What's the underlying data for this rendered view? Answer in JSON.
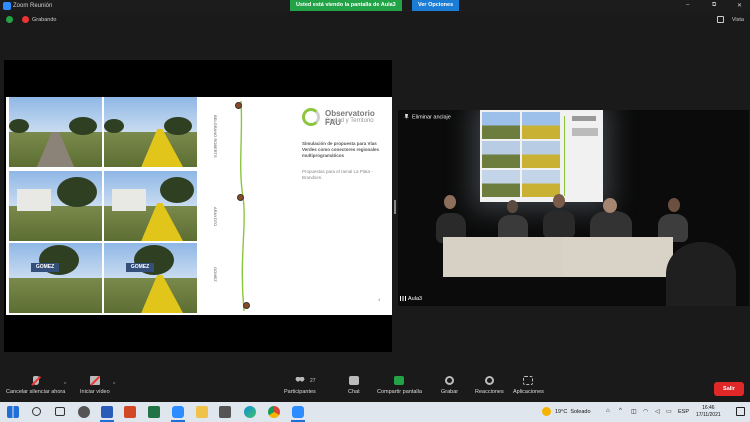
{
  "titlebar": {
    "title": "Zoom Reunión",
    "share_banner": "Usted está viendo la pantalla de Aula3",
    "view_options": "Ver Opciones",
    "controls": [
      "–",
      "⧉",
      "✕"
    ]
  },
  "subbar": {
    "recording": "Grabando",
    "view": "Vista"
  },
  "slide": {
    "logo_title": "Observatorio FAU",
    "logo_subtitle": "Ciudad y Territorio",
    "title": "Simulación de propuesta para Vías Verdes como conectores regionales multiprogramáticos",
    "subtitle": "Propuestas para el ramal La Plata - Brandsen.",
    "stations": [
      "BELGRANO ROBERTS",
      "ARAYOTO",
      "GOMEZ"
    ],
    "sign_text": "GOMEZ",
    "page_number": "4"
  },
  "video": {
    "unpin_label": "Eliminar anclaje",
    "participant_name": "Aula3"
  },
  "toolbar": {
    "mute": "Cancelar silenciar ahora",
    "video": "Iniciar vídeo",
    "participants": "Participantes",
    "participants_count": "27",
    "chat": "Chat",
    "share": "Compartir pantalla",
    "record": "Grabar",
    "reactions": "Reacciones",
    "apps": "Aplicaciones",
    "leave": "Salir"
  },
  "taskbar": {
    "temperature": "19°C",
    "weather": "Soleado",
    "language": "ESP",
    "time": "16:46",
    "date": "17/11/2021"
  },
  "colors": {
    "share_banner": "#23a347",
    "view_options": "#1b7cd6",
    "leave": "#e02828",
    "route": "#8cc63f"
  }
}
